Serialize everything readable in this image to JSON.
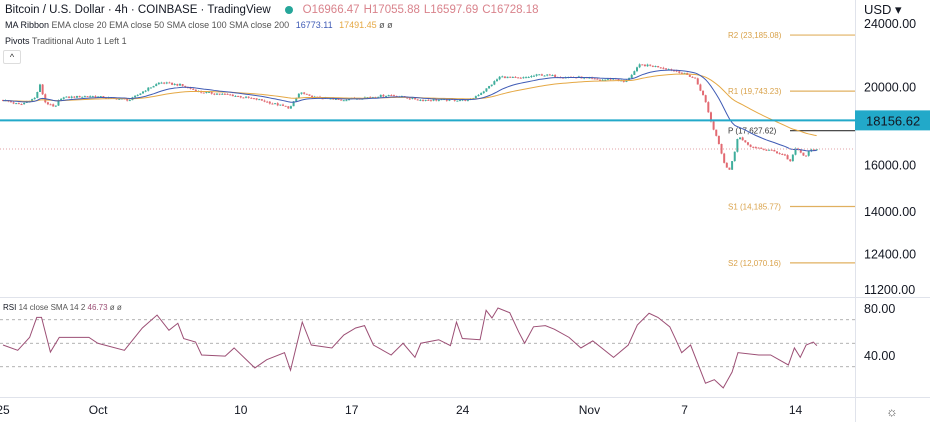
{
  "header": {
    "title": "Bitcoin / U.S. Dollar · 4h · COINBASE · TradingView",
    "status_color": "#26a69a",
    "ohlc": {
      "o": "O16966.47",
      "h": "H17055.88",
      "l": "L16597.69",
      "c": "C16728.18"
    }
  },
  "indicators": {
    "ma_ribbon": {
      "name": "MA Ribbon",
      "params": "EMA close 20 EMA close 50 SMA close 100 SMA close 200",
      "v1": "16773.11",
      "v2": "17491.45",
      "v3": "ø",
      "v4": "ø"
    },
    "pivots": {
      "name": "Pivots",
      "params": "Traditional Auto 1 Left 1"
    },
    "rsi": {
      "name": "RSI",
      "params": "14 close SMA 14 2",
      "value": "46.73",
      "v2": "ø",
      "v3": "ø"
    }
  },
  "collapse_label": "^",
  "currency_label": "USD ▾",
  "price_axis": [
    "24000.00",
    "20000.00",
    "16000.00",
    "14000.00",
    "12400.00",
    "11200.00"
  ],
  "rsi_axis": [
    "80.00",
    "40.00"
  ],
  "horizontal_line": {
    "value": 18156.62,
    "label": "18156.62",
    "color": "#22a9c9"
  },
  "pivot_levels": [
    {
      "label": "R2 (23,185.08)",
      "value": 23185.08,
      "color": "#e0b060"
    },
    {
      "label": "R1 (19,743.23)",
      "value": 19743.23,
      "color": "#e0b060"
    },
    {
      "label": "P (17,627.62)",
      "value": 17627.62,
      "color": "#333333"
    },
    {
      "label": "S1 (14,185.77)",
      "value": 14185.77,
      "color": "#e0b060"
    },
    {
      "label": "S2 (12,070.16)",
      "value": 12070.16,
      "color": "#e0b060"
    }
  ],
  "time_axis": [
    {
      "label": "25",
      "day": 0
    },
    {
      "label": "Oct",
      "day": 6
    },
    {
      "label": "10",
      "day": 15
    },
    {
      "label": "17",
      "day": 22
    },
    {
      "label": "24",
      "day": 29
    },
    {
      "label": "Nov",
      "day": 37
    },
    {
      "label": "7",
      "day": 43
    },
    {
      "label": "14",
      "day": 50
    }
  ],
  "colors": {
    "up": "#3fae9c",
    "down": "#e26a72",
    "ema20": "#3f5bb5",
    "ema50": "#e5a844",
    "rsi": "#9c4f75"
  },
  "chart_data": {
    "type": "candlestick",
    "interval": "4h",
    "last_close": 16728.18,
    "price_path": [
      [
        0,
        19250
      ],
      [
        1.07,
        18980
      ],
      [
        2.02,
        19360
      ],
      [
        2.33,
        20090
      ],
      [
        2.65,
        19140
      ],
      [
        3.28,
        18810
      ],
      [
        3.6,
        19360
      ],
      [
        4.54,
        19420
      ],
      [
        5.49,
        19470
      ],
      [
        6.75,
        19360
      ],
      [
        8.01,
        19250
      ],
      [
        8.96,
        19800
      ],
      [
        9.9,
        20240
      ],
      [
        11.17,
        20090
      ],
      [
        12.43,
        19690
      ],
      [
        14.32,
        19530
      ],
      [
        16.21,
        19250
      ],
      [
        18.11,
        18810
      ],
      [
        18.74,
        19690
      ],
      [
        19.37,
        19420
      ],
      [
        21.26,
        19250
      ],
      [
        23.15,
        19420
      ],
      [
        24.42,
        19530
      ],
      [
        26.31,
        19250
      ],
      [
        29.46,
        19250
      ],
      [
        30.41,
        19800
      ],
      [
        31.36,
        20580
      ],
      [
        32.62,
        20470
      ],
      [
        33.88,
        20700
      ],
      [
        35.14,
        20580
      ],
      [
        36.4,
        20530
      ],
      [
        37.67,
        20380
      ],
      [
        38.61,
        20470
      ],
      [
        39.24,
        20240
      ],
      [
        40.19,
        21290
      ],
      [
        41.45,
        21160
      ],
      [
        42.71,
        20860
      ],
      [
        43.66,
        20470
      ],
      [
        44.29,
        19250
      ],
      [
        44.73,
        17900
      ],
      [
        45.11,
        17160
      ],
      [
        45.55,
        15960
      ],
      [
        45.87,
        15740
      ],
      [
        46.18,
        16670
      ],
      [
        46.37,
        17400
      ],
      [
        46.81,
        17010
      ],
      [
        47.44,
        16770
      ],
      [
        48.39,
        16670
      ],
      [
        49.34,
        16430
      ],
      [
        49.65,
        16100
      ],
      [
        49.97,
        16770
      ],
      [
        50.28,
        16570
      ],
      [
        50.6,
        16340
      ],
      [
        50.91,
        16670
      ],
      [
        51.42,
        16728
      ]
    ],
    "rsi_path": [
      [
        0,
        48.5
      ],
      [
        0.93,
        44
      ],
      [
        1.68,
        55
      ],
      [
        2.13,
        72
      ],
      [
        2.43,
        72
      ],
      [
        2.99,
        42.5
      ],
      [
        3.55,
        55
      ],
      [
        5.42,
        55
      ],
      [
        5.98,
        50
      ],
      [
        7.66,
        44
      ],
      [
        8.79,
        63
      ],
      [
        9.72,
        74
      ],
      [
        10.47,
        61
      ],
      [
        11.03,
        67
      ],
      [
        11.4,
        54
      ],
      [
        12.15,
        51
      ],
      [
        12.53,
        40
      ],
      [
        14.02,
        39
      ],
      [
        14.58,
        46
      ],
      [
        15.89,
        29
      ],
      [
        16.64,
        36
      ],
      [
        17.76,
        42
      ],
      [
        18.14,
        27
      ],
      [
        18.88,
        68
      ],
      [
        19.45,
        48.5
      ],
      [
        20.75,
        46
      ],
      [
        21.5,
        57
      ],
      [
        22.25,
        63
      ],
      [
        22.81,
        65
      ],
      [
        23.37,
        48.5
      ],
      [
        24.49,
        40
      ],
      [
        25.24,
        50
      ],
      [
        25.99,
        38
      ],
      [
        26.36,
        50
      ],
      [
        27.49,
        53
      ],
      [
        28.23,
        48
      ],
      [
        28.61,
        68
      ],
      [
        28.98,
        54
      ],
      [
        30.1,
        53
      ],
      [
        30.48,
        78
      ],
      [
        30.85,
        71.5
      ],
      [
        31.23,
        80
      ],
      [
        31.97,
        76
      ],
      [
        32.54,
        59.5
      ],
      [
        32.91,
        50
      ],
      [
        33.47,
        64
      ],
      [
        34.22,
        65
      ],
      [
        34.78,
        62
      ],
      [
        35.71,
        55
      ],
      [
        36.46,
        46
      ],
      [
        37.21,
        52
      ],
      [
        38.52,
        38
      ],
      [
        39.45,
        48.5
      ],
      [
        40.02,
        65.5
      ],
      [
        40.76,
        75.5
      ],
      [
        41.32,
        72
      ],
      [
        42.07,
        64
      ],
      [
        42.45,
        53
      ],
      [
        42.82,
        42
      ],
      [
        43.38,
        48.5
      ],
      [
        44.32,
        16
      ],
      [
        44.88,
        19
      ],
      [
        45.44,
        12
      ],
      [
        46.0,
        25.5
      ],
      [
        46.37,
        42
      ],
      [
        47.68,
        40
      ],
      [
        48.43,
        40
      ],
      [
        49.55,
        31.5
      ],
      [
        49.93,
        46
      ],
      [
        50.3,
        38
      ],
      [
        50.67,
        48.5
      ],
      [
        51.12,
        51
      ],
      [
        51.35,
        48
      ]
    ],
    "rsi_bands": [
      70,
      50,
      30
    ]
  }
}
